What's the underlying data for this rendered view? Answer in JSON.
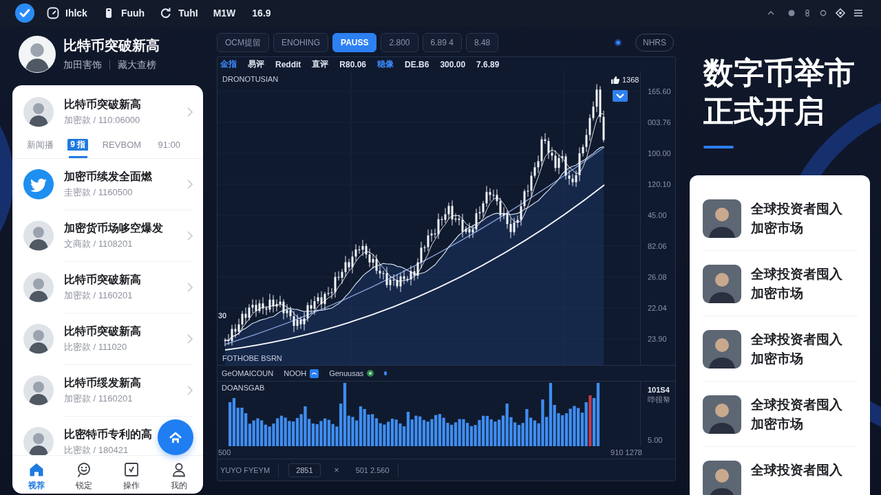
{
  "top_bar": {
    "items": [
      {
        "kind": "icon",
        "label": "Ihlck"
      },
      {
        "kind": "icon",
        "label": "Fuuh"
      },
      {
        "kind": "icon",
        "label": "TuhI"
      },
      {
        "kind": "plain",
        "label": "M1W"
      },
      {
        "kind": "plain",
        "label": "16.9"
      }
    ]
  },
  "profile": {
    "name": "比特币突破新高",
    "tags": [
      "加田害饰",
      "藏大查榜"
    ]
  },
  "news": {
    "featured": {
      "kind": "avatar",
      "title": "比特币突破新高",
      "meta": "加密款 / 110:06000",
      "chevron": true
    },
    "tabs": [
      {
        "label": "新闻播",
        "selected": false
      },
      {
        "label": "9 指",
        "selected": true
      },
      {
        "label": "REVBOM",
        "selected": false
      },
      {
        "label": "91:00",
        "selected": false
      }
    ],
    "items": [
      {
        "kind": "logo",
        "title": "加密币续发全面燃",
        "meta": "圭密款 / 1160500",
        "chevron": true
      },
      {
        "kind": "avatar",
        "title": "加密货币场哆空爆发",
        "meta": "文商款 / 1108201",
        "chevron": true
      },
      {
        "kind": "avatar",
        "title": "比特币突破新高",
        "meta": "加密款 / 1160201",
        "chevron": true
      },
      {
        "kind": "avatar",
        "title": "比特币突破新高",
        "meta": "比密款 / 111020",
        "chevron": true
      },
      {
        "kind": "avatar",
        "title": "比特币绥发新高",
        "meta": "加密款 / 1160201",
        "chevron": true
      },
      {
        "kind": "avatar",
        "title": "比密特币专利的高",
        "meta": "比密款 / 180421",
        "chevron": false
      }
    ]
  },
  "bottom_nav": [
    {
      "label": "视荐",
      "selected": true
    },
    {
      "label": "锐定",
      "selected": false
    },
    {
      "label": "操作",
      "selected": false
    },
    {
      "label": "我的",
      "selected": false
    }
  ],
  "chart_panel": {
    "buttons": [
      {
        "label": "OCM提留",
        "selected": false
      },
      {
        "label": "ENOHING",
        "selected": false
      },
      {
        "label": "PAUSS",
        "selected": true
      },
      {
        "label": "2.800",
        "selected": false
      },
      {
        "label": "6.89 4",
        "selected": false
      },
      {
        "label": "8.48",
        "selected": false
      }
    ],
    "mode": "NHRS",
    "quotes": [
      {
        "text": "金指",
        "highlight": true
      },
      {
        "text": "易评",
        "highlight": false
      },
      {
        "text": "Reddit",
        "highlight": false
      },
      {
        "text": "直评",
        "highlight": false
      },
      {
        "text": "R80.06",
        "highlight": false
      },
      {
        "text": "稳像",
        "highlight": true
      },
      {
        "text": "DE.B6",
        "highlight": false
      },
      {
        "text": "300.00",
        "highlight": false
      },
      {
        "text": "7.6.89",
        "highlight": false
      }
    ],
    "plot_title": "DRONOTUSIAN",
    "likes": "1368",
    "left_label": "30",
    "plot_caption": "FOTHOBE BSRN",
    "price_axis": [
      "165.60",
      "003.76",
      "100.00",
      "120.10",
      "45.00",
      "82.06",
      "26.08",
      "22.04",
      "23.90"
    ],
    "legend": [
      {
        "kind": "text",
        "label": "GeOMAICOUN"
      },
      {
        "kind": "square",
        "label": "NOOH"
      },
      {
        "kind": "round",
        "label": "Genuusas"
      }
    ],
    "volume_title": "DOANSGAB",
    "volume_axis": [
      "101S4",
      "哔很帑",
      "5.00"
    ],
    "time_axis": [
      "500",
      "910 1278"
    ],
    "status": [
      {
        "kind": "cell",
        "text": "YUYO FYEYM"
      },
      {
        "kind": "box",
        "text": "2851"
      },
      {
        "kind": "close",
        "text": "×"
      },
      {
        "kind": "cell",
        "text": "501 2.560"
      }
    ]
  },
  "headline": {
    "lines": [
      "数字币举市",
      "正式开启"
    ],
    "cards": [
      {
        "title": "全球投资者囤入",
        "subtitle": "加密市场"
      },
      {
        "title": "全球投资者囤入",
        "subtitle": "加密市场"
      },
      {
        "title": "全球投资者囤入",
        "subtitle": "加密市场"
      },
      {
        "title": "全球投资者囤入",
        "subtitle": "加密市场"
      },
      {
        "title": "全球投资者囤入"
      }
    ]
  }
}
